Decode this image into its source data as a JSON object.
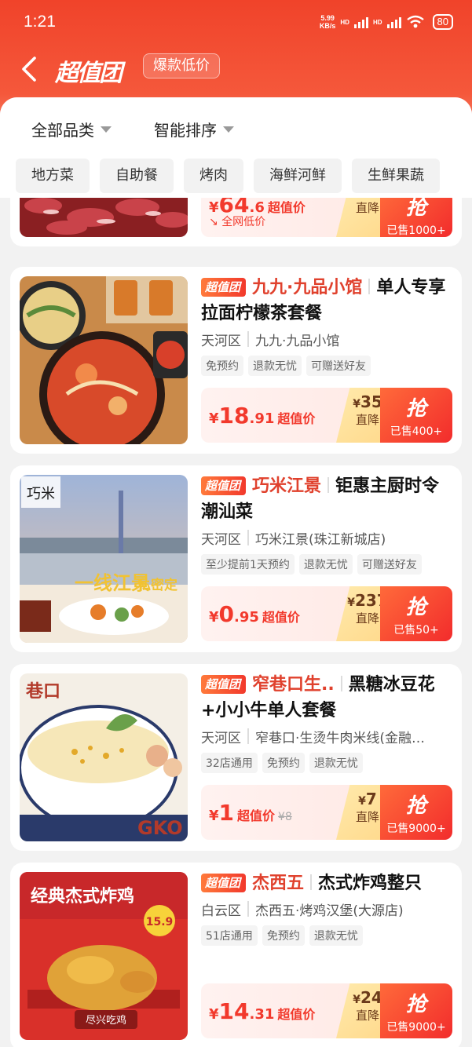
{
  "status": {
    "time": "1:21",
    "net_speed": "5.99",
    "net_unit": "KB/s",
    "hd1": "HD",
    "hd2": "HD",
    "battery": "80"
  },
  "header": {
    "brand": "超值团",
    "tag": "爆款低价"
  },
  "filters": {
    "category": "全部品类",
    "sort": "智能排序"
  },
  "chips": [
    "地方菜",
    "自助餐",
    "烤肉",
    "海鲜河鲜",
    "生鲜果蔬"
  ],
  "common": {
    "badge": "超值团",
    "grab": "抢",
    "drop_label": "直降",
    "value_label": "超值价",
    "yen": "¥"
  },
  "partial_card": {
    "price_int": "64",
    "price_dec": ".6",
    "lowest": "全网低价",
    "sold": "已售1000+"
  },
  "deals": [
    {
      "shop": "九九·九品小馆",
      "dish": "单人专享拉面柠檬茶套餐",
      "district": "天河区",
      "store": "九九·九品小馆",
      "tags": [
        "免预约",
        "退款无忧",
        "可赠送好友"
      ],
      "price_int": "18",
      "price_dec": ".91",
      "drop": "35",
      "sold": "已售400+"
    },
    {
      "shop": "巧米江景",
      "dish": "钜惠主厨时令潮汕菜",
      "district": "天河区",
      "store": "巧米江景(珠江新城店)",
      "tags": [
        "至少提前1天预约",
        "退款无忧",
        "可赠送好友"
      ],
      "price_int": "0",
      "price_dec": ".95",
      "drop": "237",
      "sold": "已售50+",
      "img_text": "一线江景",
      "img_text2": "私密定",
      "img_logo": "巧米"
    },
    {
      "shop": "窄巷口生..",
      "dish": "黑糖冰豆花+小小牛单人套餐",
      "district": "天河区",
      "store": "窄巷口·生烫牛肉米线(金融…",
      "tags": [
        "32店通用",
        "免预约",
        "退款无忧"
      ],
      "price_int": "1",
      "price_dec": "",
      "orig": "¥8",
      "drop": "7",
      "sold": "已售9000+",
      "img_text": "巷口",
      "img_text2": "GKO"
    },
    {
      "shop": "杰西五",
      "dish": "杰式炸鸡整只",
      "district": "白云区",
      "store": "杰西五·烤鸡汉堡(大源店)",
      "tags": [
        "51店通用",
        "免预约",
        "退款无忧"
      ],
      "price_int": "14",
      "price_dec": ".31",
      "drop": "24",
      "sold": "已售9000+",
      "img_text": "经典杰式炸鸡",
      "img_price": "15.9",
      "img_ribbon": "尽兴吃鸡"
    }
  ],
  "colors": {
    "brand_red": "#f2392c",
    "orange": "#ff6a3a",
    "drop_gold": "#ffd88a"
  }
}
